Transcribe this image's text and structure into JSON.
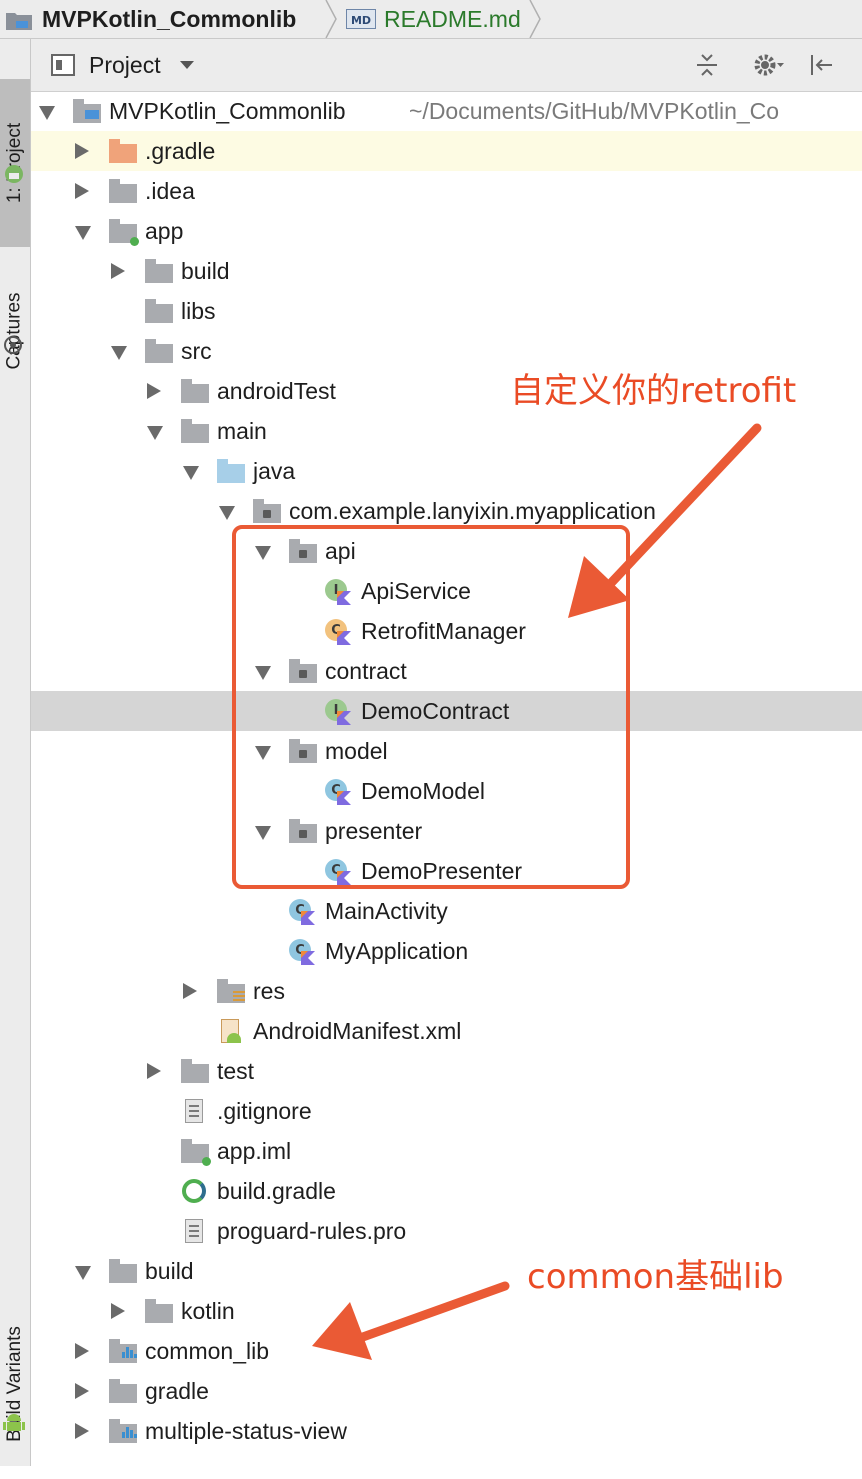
{
  "breadcrumb": {
    "project": "MVPKotlin_Commonlib",
    "file": "README.md",
    "file_icon_text": "MD"
  },
  "tool_strip": {
    "project_tab": "1: Project",
    "captures_tab": "Captures",
    "build_variants_tab": "Build Variants"
  },
  "header": {
    "view_label": "Project"
  },
  "tree": [
    {
      "label": "MVPKotlin_Commonlib",
      "path": "~/Documents/GitHub/MVPKotlin_Co",
      "icon": "project-folder-icon",
      "arrow": "down",
      "depth": 0
    },
    {
      "label": ".gradle",
      "icon": "folder-orange-icon",
      "arrow": "right",
      "depth": 1
    },
    {
      "label": ".idea",
      "icon": "folder-icon",
      "arrow": "right",
      "depth": 1
    },
    {
      "label": "app",
      "icon": "module-folder-icon",
      "arrow": "down",
      "depth": 1
    },
    {
      "label": "build",
      "icon": "folder-icon",
      "arrow": "right",
      "depth": 2
    },
    {
      "label": "libs",
      "icon": "folder-icon",
      "arrow": "none",
      "depth": 2
    },
    {
      "label": "src",
      "icon": "folder-icon",
      "arrow": "down",
      "depth": 2
    },
    {
      "label": "androidTest",
      "icon": "folder-icon",
      "arrow": "right",
      "depth": 3
    },
    {
      "label": "main",
      "icon": "folder-icon",
      "arrow": "down",
      "depth": 3
    },
    {
      "label": "java",
      "icon": "source-folder-icon",
      "arrow": "down",
      "depth": 4
    },
    {
      "label": "com.example.lanyixin.myapplication",
      "icon": "package-icon",
      "arrow": "down",
      "depth": 5
    },
    {
      "label": "api",
      "icon": "package-icon",
      "arrow": "down",
      "depth": 6
    },
    {
      "label": "ApiService",
      "icon": "kotlin-interface-icon",
      "arrow": "none",
      "depth": 7
    },
    {
      "label": "RetrofitManager",
      "icon": "kotlin-abstract-class-icon",
      "arrow": "none",
      "depth": 7
    },
    {
      "label": "contract",
      "icon": "package-icon",
      "arrow": "down",
      "depth": 6
    },
    {
      "label": "DemoContract",
      "icon": "kotlin-interface-icon",
      "arrow": "none",
      "depth": 7
    },
    {
      "label": "model",
      "icon": "package-icon",
      "arrow": "down",
      "depth": 6
    },
    {
      "label": "DemoModel",
      "icon": "kotlin-class-icon",
      "arrow": "none",
      "depth": 7
    },
    {
      "label": "presenter",
      "icon": "package-icon",
      "arrow": "down",
      "depth": 6
    },
    {
      "label": "DemoPresenter",
      "icon": "kotlin-class-icon",
      "arrow": "none",
      "depth": 7
    },
    {
      "label": "MainActivity",
      "icon": "kotlin-class-icon",
      "arrow": "none",
      "depth": 6
    },
    {
      "label": "MyApplication",
      "icon": "kotlin-class-icon",
      "arrow": "none",
      "depth": 6
    },
    {
      "label": "res",
      "icon": "resource-folder-icon",
      "arrow": "right",
      "depth": 4
    },
    {
      "label": "AndroidManifest.xml",
      "icon": "manifest-icon",
      "arrow": "none",
      "depth": 4
    },
    {
      "label": "test",
      "icon": "folder-icon",
      "arrow": "right",
      "depth": 3
    },
    {
      "label": ".gitignore",
      "icon": "text-file-icon",
      "arrow": "none",
      "depth": 3
    },
    {
      "label": "app.iml",
      "icon": "iml-file-icon",
      "arrow": "none",
      "depth": 3
    },
    {
      "label": "build.gradle",
      "icon": "gradle-file-icon",
      "arrow": "none",
      "depth": 3
    },
    {
      "label": "proguard-rules.pro",
      "icon": "text-file-icon",
      "arrow": "none",
      "depth": 3
    },
    {
      "label": "build",
      "icon": "folder-icon",
      "arrow": "down",
      "depth": 1
    },
    {
      "label": "kotlin",
      "icon": "folder-icon",
      "arrow": "right",
      "depth": 2
    },
    {
      "label": "common_lib",
      "icon": "library-module-icon",
      "arrow": "right",
      "depth": 1
    },
    {
      "label": "gradle",
      "icon": "folder-icon",
      "arrow": "right",
      "depth": 1
    },
    {
      "label": "multiple-status-view",
      "icon": "library-module-icon",
      "arrow": "right",
      "depth": 1
    }
  ],
  "selected_index": 15,
  "highlighted_index": 1,
  "annotations": {
    "retrofit_note": "自定义你的retrofit",
    "common_note": "common基础lib",
    "color": "#ea4b25"
  },
  "colors": {
    "folder": "#a9abaf",
    "gradle_folder": "#f0a37a",
    "source_folder": "#a7cfe8",
    "selection": "#d5d5d5"
  }
}
